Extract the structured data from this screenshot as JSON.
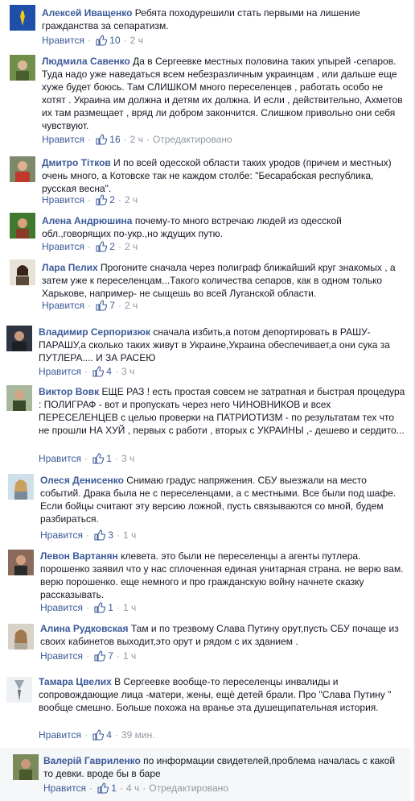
{
  "ui": {
    "like_label": "Нравится",
    "dot": "·",
    "edited_label": "Отредактировано"
  },
  "comments": [
    {
      "author": "Алексей Иващенко",
      "text": "Ребята походурешили стать первыми на лишение гражданства за сепаратизм.",
      "likes": "10",
      "time": "2 ч",
      "edited": ""
    },
    {
      "author": "Людмила Савенко",
      "text": "Да в Сергеевке местных половина таких упырей -сепаров. Туда надо уже наведаться всем небезразличным украинцам , или дальше еще хуже будет боюсь. Там СЛИШКОМ много переселенцев , работать особо не хотят . Украина им должна и детям их должна. И если , действительно, Ахметов их там размещает , вряд ли добром закончится. Слишком привольно они себя чувствуют.",
      "likes": "16",
      "time": "2 ч",
      "edited": "Отредактировано"
    },
    {
      "author": "Дмитро Тітков",
      "text": "И по всей одесской области таких уродов (причем и местных) очень много, а Котовске так не каждом столбе: \"Бесарабская республика, русская весна\".",
      "likes": "2",
      "time": "2 ч",
      "edited": ""
    },
    {
      "author": "Алена Андрюшина",
      "text": "почему-то много встречаю людей из одесской обл.,говорящих по-укр.,но ждущих путю.",
      "likes": "2",
      "time": "2 ч",
      "edited": ""
    },
    {
      "author": "Лара Пелих",
      "text": "Прогоните сначала через полиграф ближайший круг знакомых , а затем уже к переселенцам...Такого количества сепаров, как в одном только Харькове, например- не сыщешь во всей Луганской области.",
      "likes": "7",
      "time": "2 ч",
      "edited": ""
    },
    {
      "author": "Владимир Серпоризюк",
      "text": "сначала избить,а потом депортировать в РАШУ-ПАРАШУ,а сколько таких живут в Украине,Украина обеспечивает,а они сука за ПУТЛЕРА.... И ЗА РАСЕЮ",
      "likes": "4",
      "time": "3 ч",
      "edited": ""
    },
    {
      "author": "Виктор Вовк",
      "text": "ЕЩЕ РАЗ ! есть простая совсем не затратная и быстрая процедура : ПОЛИГРАФ - вот и пропускать через него ЧИНОВНИКОВ и всех ПЕРЕСЕЛЕНЦЕВ с целью проверки на ПАТРИОТИЗМ - по результатам тех что не прошли НА ХУЙ , первых с работи , вторых с УКРАИНЫ ,- дешево и сердито...",
      "likes": "1",
      "time": "3 ч",
      "edited": ""
    },
    {
      "author": "Олеся Денисенко",
      "text": "Снимаю градус напряжения. СБУ выезжали на место событий. Драка была не с переселенцами, а с местными. Все были под шафе. Если бойцы считают эту версию ложной, пусть связываются со мной, будем разбираться.",
      "likes": "3",
      "time": "1 ч",
      "edited": ""
    },
    {
      "author": "Левон Вартанян",
      "text": "клевета. это были не переселенцы а агенты путлера. порошенко заявил что у нас сплоченная единая унитарная страна. не верю вам. верю порошенко. еще немного и про гражданскую войну начнете сказку рассказывать.",
      "likes": "1",
      "time": "1 ч",
      "edited": ""
    },
    {
      "author": "Алина Рудковская",
      "text": "Там и по трезвому Слава Путину орут,пусть СБУ почаще из своих кабинетов выходит,это орут и рядом с их зданием .",
      "likes": "7",
      "time": "1 ч",
      "edited": ""
    },
    {
      "author": "Тамара Цвелих",
      "text": "В Сергеевке вообще-то переселенцы инвалиды и сопровождающие лица -матери, жены, ещё детей брали. Про \"Слава Путину \" вообще смешно. Больше похожа на вранье эта душещипательная история.",
      "likes": "4",
      "time": "39 мин.",
      "edited": ""
    },
    {
      "author": "Валерій Гавриленко",
      "text": "по информации свидетелей,проблема началась с какой то девки. вроде бы в баре",
      "likes": "1",
      "time": "4 ч",
      "edited": "Отредактировано"
    }
  ]
}
